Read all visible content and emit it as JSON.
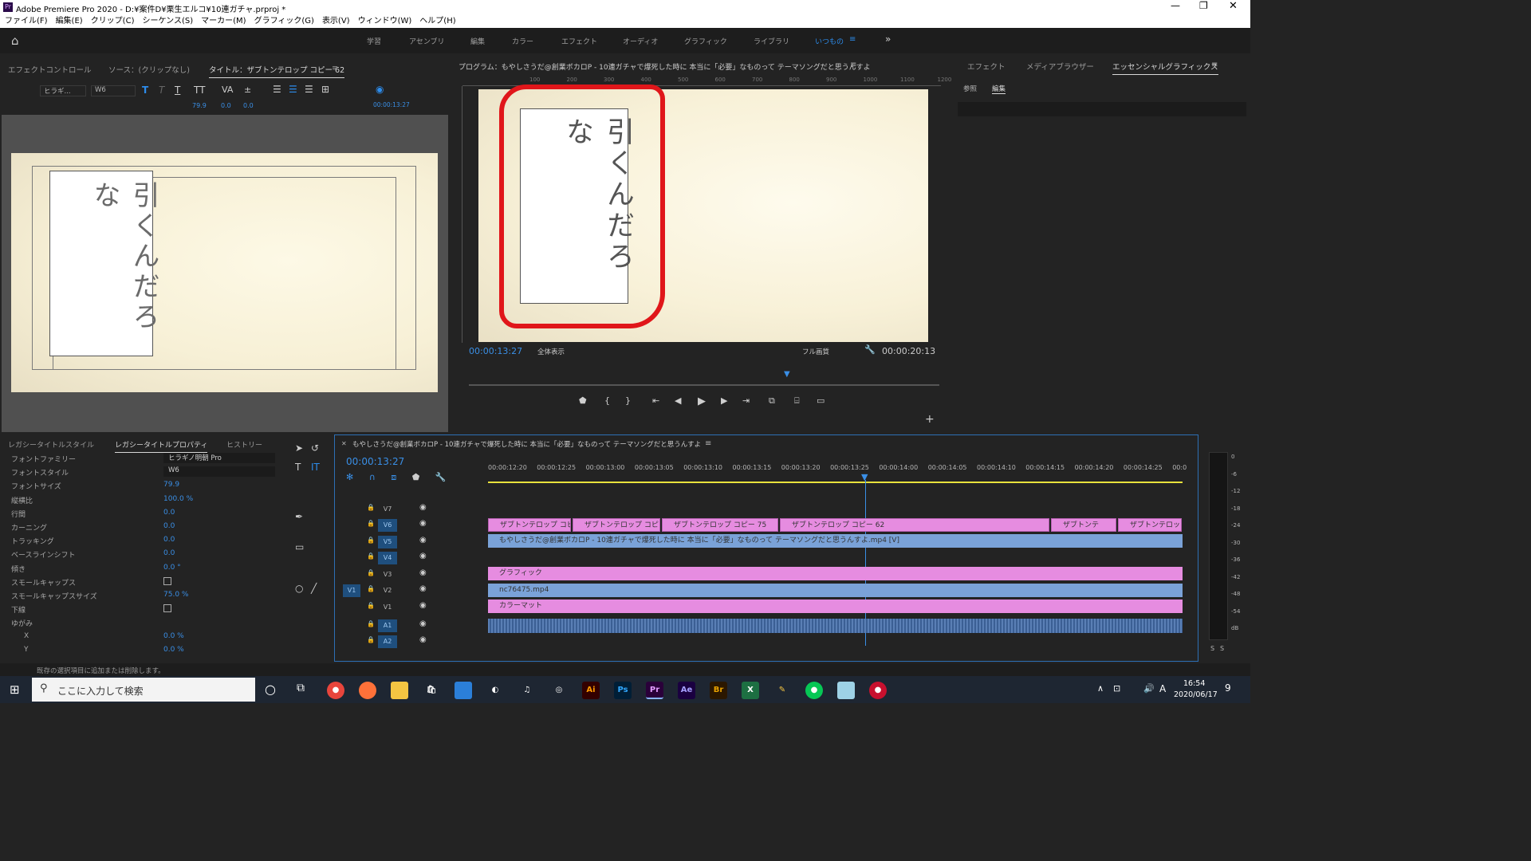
{
  "window": {
    "title": "Adobe Premiere Pro 2020 - D:¥案件D¥栗生エルコ¥10連ガチャ.prproj *",
    "app_icon": "Pr"
  },
  "menu": [
    "ファイル(F)",
    "編集(E)",
    "クリップ(C)",
    "シーケンス(S)",
    "マーカー(M)",
    "グラフィック(G)",
    "表示(V)",
    "ウィンドウ(W)",
    "ヘルプ(H)"
  ],
  "workspaces": [
    "学習",
    "アセンブリ",
    "編集",
    "カラー",
    "エフェクト",
    "オーディオ",
    "グラフィック",
    "ライブラリ",
    "いつもの"
  ],
  "active_workspace": "いつもの",
  "left_panel": {
    "tabs": [
      "エフェクトコントロール",
      "ソース：(クリップなし)",
      "タイトル：ザブトンテロップ コピー 62"
    ],
    "font_family": "ヒラギ...",
    "font_style": "W6",
    "size": "79.9",
    "kerning": "0.0",
    "tracking": "0.0",
    "timecode": "00:00:13:27",
    "vertical_text": "引くんだろな"
  },
  "program": {
    "title": "プログラム：もやしさうだ@創業ボカロP - 10連ガチャで爆死した時に 本当に「必要」なものって テーマソングだと思うんすよ",
    "timecode": "00:00:13:27",
    "fit": "全体表示",
    "quality": "フル画質",
    "duration": "00:00:20:13",
    "ruler": [
      "100",
      "200",
      "300",
      "400",
      "500",
      "600",
      "700",
      "800",
      "900",
      "1000",
      "1100",
      "1200"
    ]
  },
  "right_panel": {
    "tabs": [
      "エフェクト",
      "メディアブラウザー",
      "エッセンシャルグラフィックス"
    ],
    "subtabs": [
      "参照",
      "編集"
    ]
  },
  "props": {
    "tabs": [
      "レガシータイトルスタイル",
      "レガシータイトルプロパティ",
      "ヒストリー"
    ],
    "rows": [
      {
        "label": "フォントファミリー",
        "value": "ヒラギノ明朝 Pro"
      },
      {
        "label": "フォントスタイル",
        "value": "W6"
      },
      {
        "label": "フォントサイズ",
        "value": "79.9"
      },
      {
        "label": "縦横比",
        "value": "100.0 %"
      },
      {
        "label": "行間",
        "value": "0.0"
      },
      {
        "label": "カーニング",
        "value": "0.0"
      },
      {
        "label": "トラッキング",
        "value": "0.0"
      },
      {
        "label": "ベースラインシフト",
        "value": "0.0"
      },
      {
        "label": "傾き",
        "value": "0.0 °"
      },
      {
        "label": "スモールキャップス",
        "value": ""
      },
      {
        "label": "スモールキャップスサイズ",
        "value": "75.0 %"
      },
      {
        "label": "下線",
        "value": ""
      },
      {
        "label": "ゆがみ",
        "value": ""
      },
      {
        "label": "X",
        "value": "0.0 %"
      },
      {
        "label": "Y",
        "value": "0.0 %"
      }
    ]
  },
  "timeline": {
    "title": "もやしさうだ@創業ボカロP - 10連ガチャで爆死した時に 本当に「必要」なものって テーマソングだと思うんすよ",
    "timecode": "00:00:13:27",
    "ruler": [
      "00:00:12:20",
      "00:00:12:25",
      "00:00:13:00",
      "00:00:13:05",
      "00:00:13:10",
      "00:00:13:15",
      "00:00:13:20",
      "00:00:13:25",
      "00:00:14:00",
      "00:00:14:05",
      "00:00:14:10",
      "00:00:14:15",
      "00:00:14:20",
      "00:00:14:25",
      "00:0"
    ],
    "tracks": [
      "V7",
      "V6",
      "V5",
      "V4",
      "V3",
      "V2",
      "V1",
      "A1",
      "A2"
    ],
    "clips": {
      "v6": [
        "ザブトンテロップ コピー 59",
        "ザブトンテロップ コピ",
        "ザブトンテロップ コピー 75",
        "ザブトンテロップ コピー 62",
        "ザブトンテ",
        "ザブトンテロッ"
      ],
      "v5": "もやしさうだ@創業ボカロP - 10連ガチャで爆死した時に 本当に「必要」なものって テーマソングだと思うんすよ.mp4 [V]",
      "v3": "グラフィック",
      "v2": "nc76475.mp4",
      "v1": "カラーマット"
    },
    "src_patch": "V1"
  },
  "meter": [
    "0",
    "-6",
    "-12",
    "-18",
    "-24",
    "-30",
    "-36",
    "-42",
    "-48",
    "-54",
    "dB"
  ],
  "status": "既存の選択項目に追加または削除します。",
  "taskbar": {
    "search": "ここに入力して検索",
    "time": "16:54",
    "date": "2020/06/17",
    "ime": "A",
    "notif": "9"
  }
}
